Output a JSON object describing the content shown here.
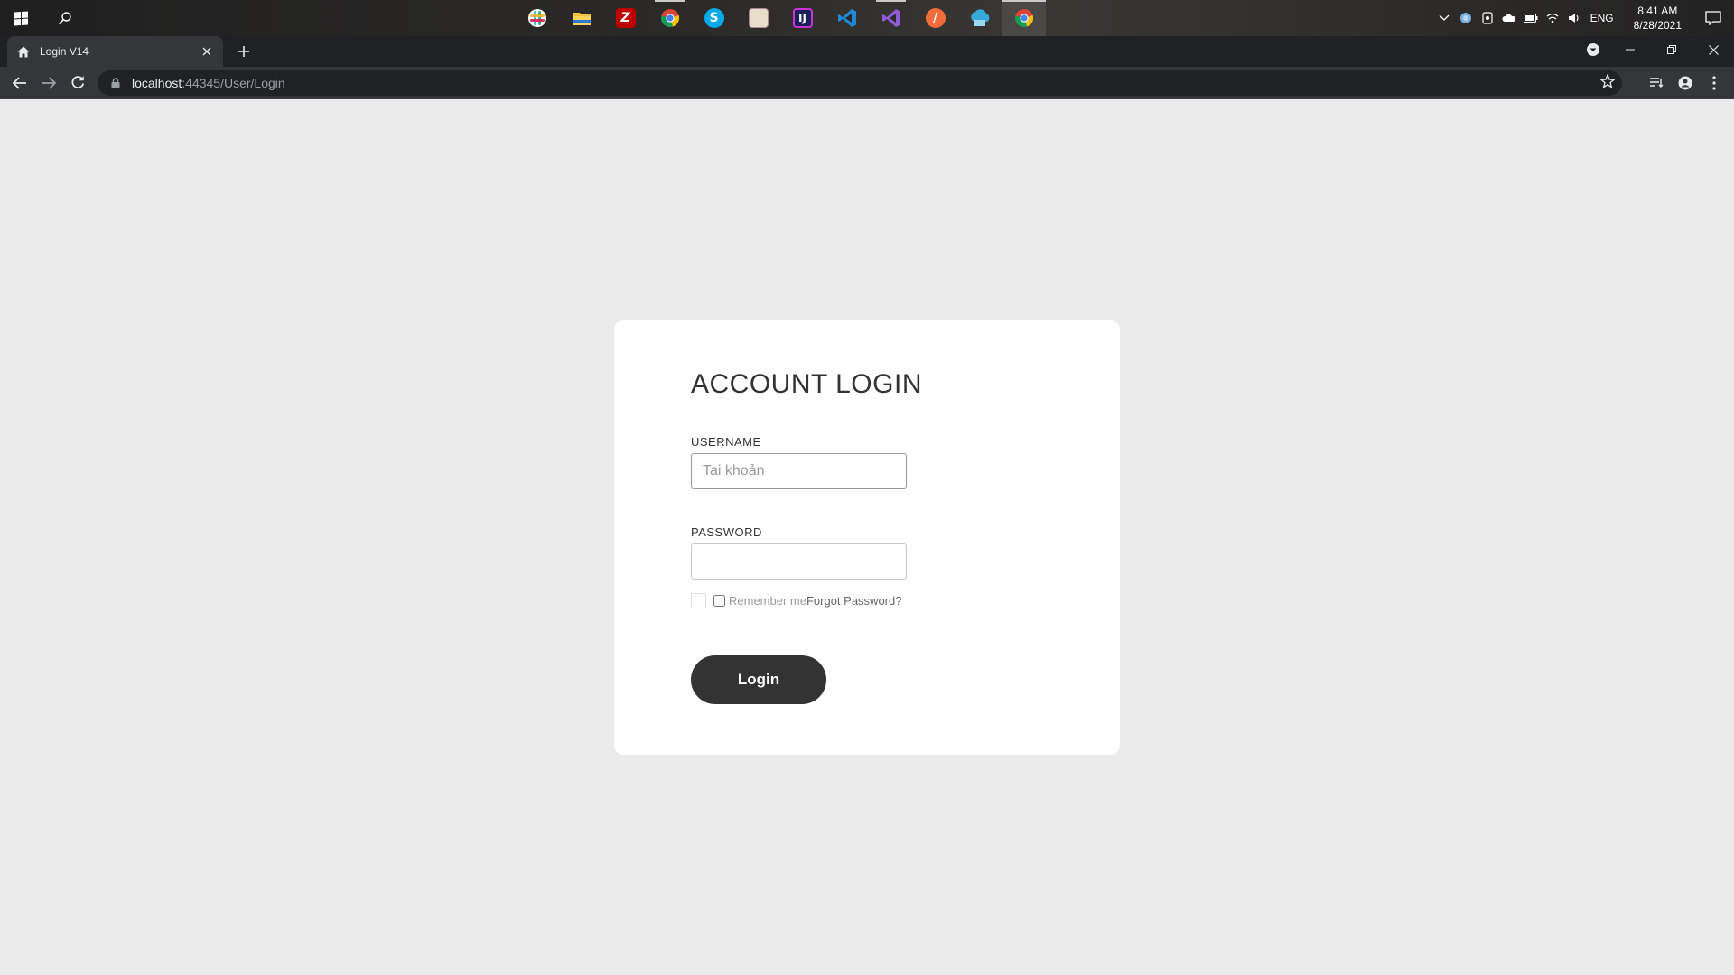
{
  "taskbar": {
    "apps": [
      {
        "name": "slack",
        "glyph": "✱",
        "color": "#e8e8e8"
      },
      {
        "name": "file-explorer",
        "glyph": "",
        "color": "#f0c040"
      },
      {
        "name": "filezilla",
        "glyph": "Z",
        "color": "#bf0000"
      },
      {
        "name": "chrome",
        "glyph": "",
        "color": "#4caf50"
      },
      {
        "name": "skype",
        "glyph": "S",
        "color": "#00a9e8"
      },
      {
        "name": "image-app",
        "glyph": "",
        "color": "#d9c9b0"
      },
      {
        "name": "intellij",
        "glyph": "J",
        "color": "#1b1f5a"
      },
      {
        "name": "vscode",
        "glyph": "",
        "color": "#1e8ad6"
      },
      {
        "name": "visual-studio",
        "glyph": "",
        "color": "#8f5ad6"
      },
      {
        "name": "postman",
        "glyph": "/",
        "color": "#f26b3a"
      },
      {
        "name": "network-app",
        "glyph": "",
        "color": "#38a9d8"
      },
      {
        "name": "chrome-active",
        "glyph": "",
        "color": "#4caf50"
      }
    ],
    "language": "ENG",
    "time": "8:41 AM",
    "date": "8/28/2021"
  },
  "browser": {
    "tab_title": "Login V14",
    "url_host": "localhost",
    "url_rest": ":44345/User/Login"
  },
  "login": {
    "title": "ACCOUNT LOGIN",
    "username_label": "USERNAME",
    "username_placeholder": "Tai khoản",
    "password_label": "PASSWORD",
    "remember_label": "Remember me",
    "forgot_label": "Forgot Password?",
    "button_label": "Login"
  }
}
